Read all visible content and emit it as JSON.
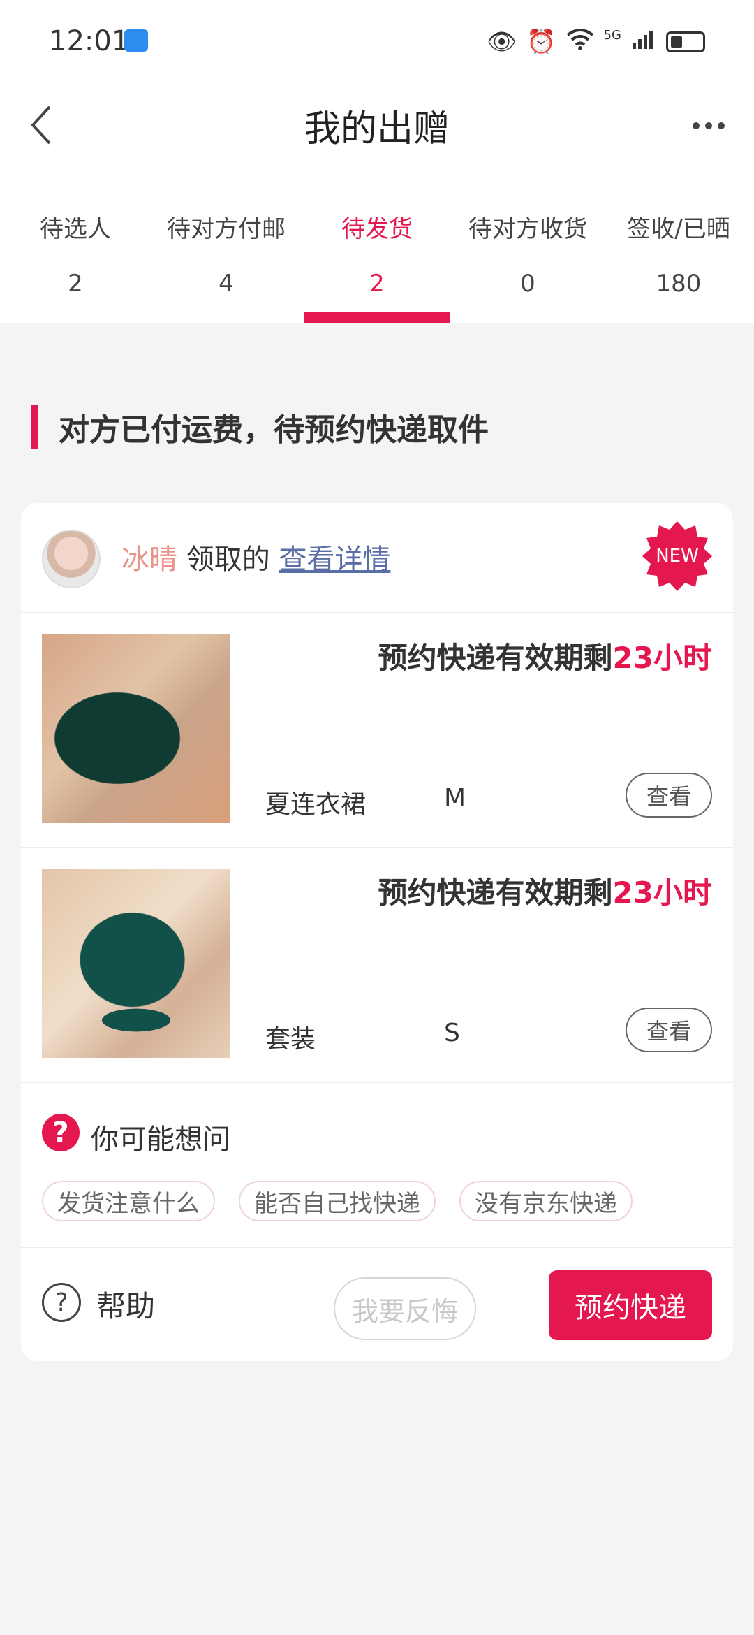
{
  "status_bar": {
    "time": "12:01",
    "network": "5G"
  },
  "header": {
    "title": "我的出赠"
  },
  "tabs": [
    {
      "label": "待选人",
      "count": "2"
    },
    {
      "label": "待对方付邮",
      "count": "4"
    },
    {
      "label": "待发货",
      "count": "2",
      "active": true
    },
    {
      "label": "待对方收货",
      "count": "0"
    },
    {
      "label": "签收/已晒",
      "count": "180"
    }
  ],
  "section": {
    "title": "对方已付运费，待预约快递取件"
  },
  "card": {
    "receiver_name": "冰晴",
    "receiver_suffix": " 领取的 ",
    "details_link": "查看详情",
    "new_badge": "NEW",
    "items": [
      {
        "deadline_prefix": "预约快递有效期剩",
        "deadline_value": "23小时",
        "name": "夏连衣裙",
        "size": "M",
        "view_label": "查看"
      },
      {
        "deadline_prefix": "预约快递有效期剩",
        "deadline_value": "23小时",
        "name": "套装",
        "size": "S",
        "view_label": "查看"
      }
    ],
    "faq": {
      "icon": "?",
      "title": "你可能想问",
      "chips": [
        "发货注意什么",
        "能否自己找快递",
        "没有京东快递"
      ]
    },
    "footer": {
      "help_icon": "?",
      "help_label": "帮助",
      "regret_label": "我要反悔",
      "book_label": "预约快递"
    }
  },
  "colors": {
    "accent": "#e5174f",
    "background": "#f4f4f4"
  }
}
